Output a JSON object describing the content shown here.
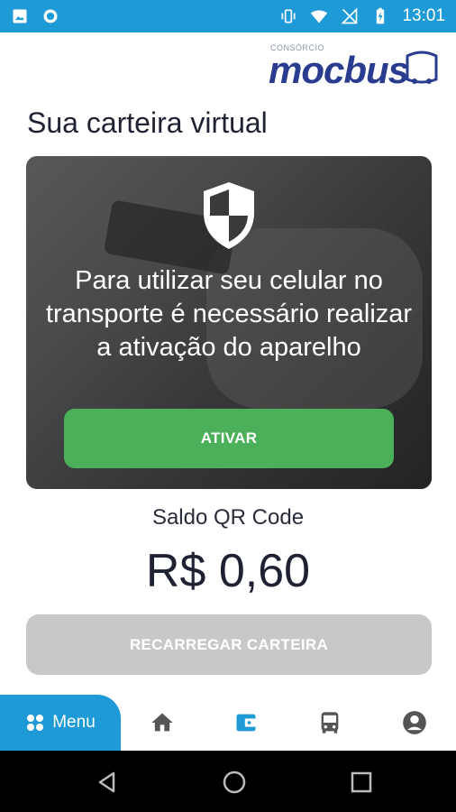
{
  "status_bar": {
    "time": "13:01",
    "icons": [
      "image-icon",
      "circle-notification-icon",
      "vibrate-icon",
      "wifi-icon",
      "no-signal-icon",
      "battery-charging-icon"
    ]
  },
  "header": {
    "logo_small": "CONSÓRCIO",
    "logo_text": "mocbus"
  },
  "page_title": "Sua carteira virtual",
  "activation_card": {
    "message": "Para utilizar seu celular no transporte é necessário realizar a ativação do aparelho",
    "button_label": "ATIVAR",
    "button_color": "#4caf5a"
  },
  "balance": {
    "label": "Saldo QR Code",
    "value": "R$ 0,60"
  },
  "recharge_button": "RECARREGAR CARTEIRA",
  "tabbar": {
    "menu_label": "Menu",
    "active_tab": "wallet",
    "accent": "#1e9bd7",
    "icons": [
      "home-icon",
      "wallet-icon",
      "bus-icon",
      "account-icon"
    ]
  },
  "navbar": {
    "icons": [
      "back-icon",
      "home-circle-icon",
      "recents-icon"
    ]
  }
}
